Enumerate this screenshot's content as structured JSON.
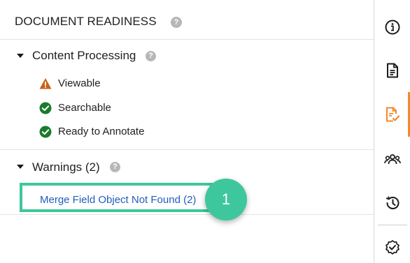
{
  "header": {
    "title": "DOCUMENT READINESS",
    "help_glyph": "?"
  },
  "content_processing": {
    "label": "Content Processing",
    "help_glyph": "?",
    "items": [
      {
        "label": "Viewable",
        "status": "warning",
        "icon": "warning-triangle-icon"
      },
      {
        "label": "Searchable",
        "status": "ok",
        "icon": "check-circle-icon"
      },
      {
        "label": "Ready to Annotate",
        "status": "ok",
        "icon": "check-circle-icon"
      }
    ]
  },
  "warnings": {
    "label": "Warnings (2)",
    "help_glyph": "?",
    "items": [
      {
        "label": "Merge Field Object Not Found (2)"
      }
    ]
  },
  "callout": {
    "number": "1",
    "color": "#3ec79c"
  },
  "sidebar": {
    "items": [
      {
        "icon": "info-icon"
      },
      {
        "icon": "document-icon"
      },
      {
        "icon": "document-check-icon",
        "active": true
      },
      {
        "icon": "users-icon"
      },
      {
        "icon": "history-icon"
      },
      {
        "icon": "certificate-check-icon"
      }
    ]
  },
  "colors": {
    "accent": "#f2892b",
    "ok": "#1c7a2e",
    "warning": "#c9611a",
    "link": "#1f5fbd",
    "highlight": "#3ec79c"
  }
}
